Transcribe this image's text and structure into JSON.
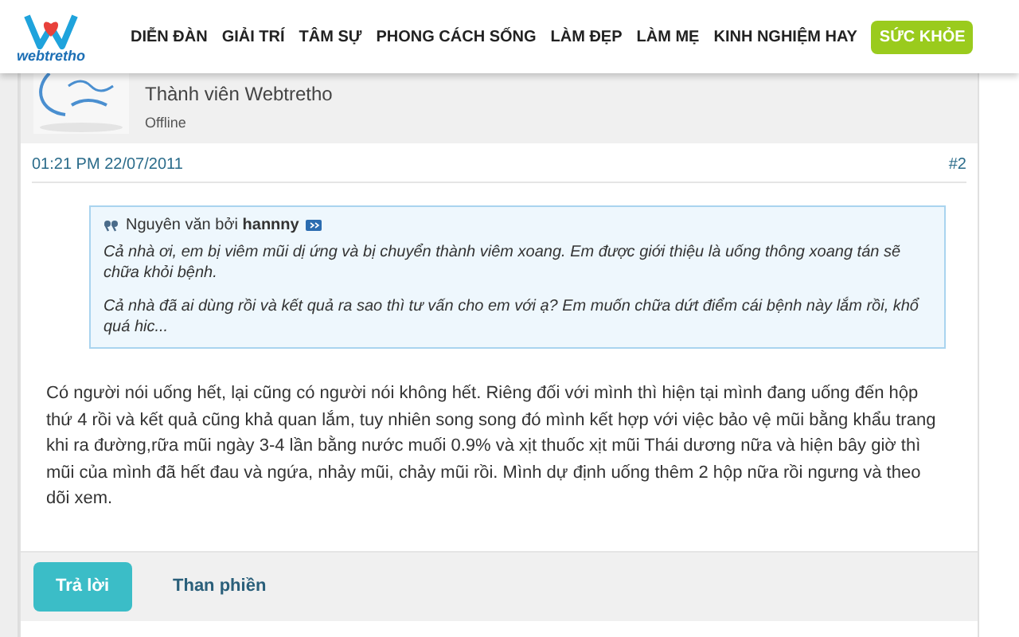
{
  "logo": {
    "text": "webtretho"
  },
  "nav": [
    {
      "label": "DIỄN ĐÀN",
      "selected": false
    },
    {
      "label": "GIẢI TRÍ",
      "selected": false
    },
    {
      "label": "TÂM SỰ",
      "selected": false
    },
    {
      "label": "PHONG CÁCH SỐNG",
      "selected": false
    },
    {
      "label": "LÀM ĐẸP",
      "selected": false
    },
    {
      "label": "LÀM MẸ",
      "selected": false
    },
    {
      "label": "KINH NGHIỆM HAY",
      "selected": false
    },
    {
      "label": "SỨC KHỎE",
      "selected": true
    }
  ],
  "author": {
    "role": "Thành viên Webtretho",
    "status": "Offline"
  },
  "post": {
    "time": "01:21 PM 22/07/2011",
    "number": "#2",
    "quote": {
      "prefix": "Nguyên văn bởi",
      "user": "hannny",
      "paragraphs": [
        "Cả nhà ơi, em bị viêm mũi dị ứng và bị chuyển thành viêm xoang. Em được giới thiệu là uống thông xoang tán sẽ chữa khỏi bệnh.",
        "Cả nhà đã ai dùng rồi và kết quả ra sao thì tư vấn cho em với ạ? Em muốn chữa dứt điểm cái bệnh này lắm rồi, khổ quá hic..."
      ]
    },
    "body": "Có người nói uống hết, lại cũng có người nói không hết. Riêng đối với mình thì hiện tại mình đang uống đến hộp thứ 4 rồi và kết quả cũng khả quan lắm, tuy nhiên song song đó mình kết hợp với việc bảo vệ mũi bằng khẩu trang khi ra đường,rữa mũi ngày 3-4 lần bằng nước muối 0.9% và xịt thuốc xịt mũi Thái dương nữa và hiện bây giờ thì mũi của mình đã hết đau và ngứa, nhảy mũi, chảy mũi rồi. Mình dự định uống thêm 2 hộp nữa rồi ngưng và theo dõi xem."
  },
  "actions": [
    {
      "kind": "primary",
      "label": "Trả lời"
    },
    {
      "kind": "link",
      "label": "Than phiền"
    }
  ]
}
